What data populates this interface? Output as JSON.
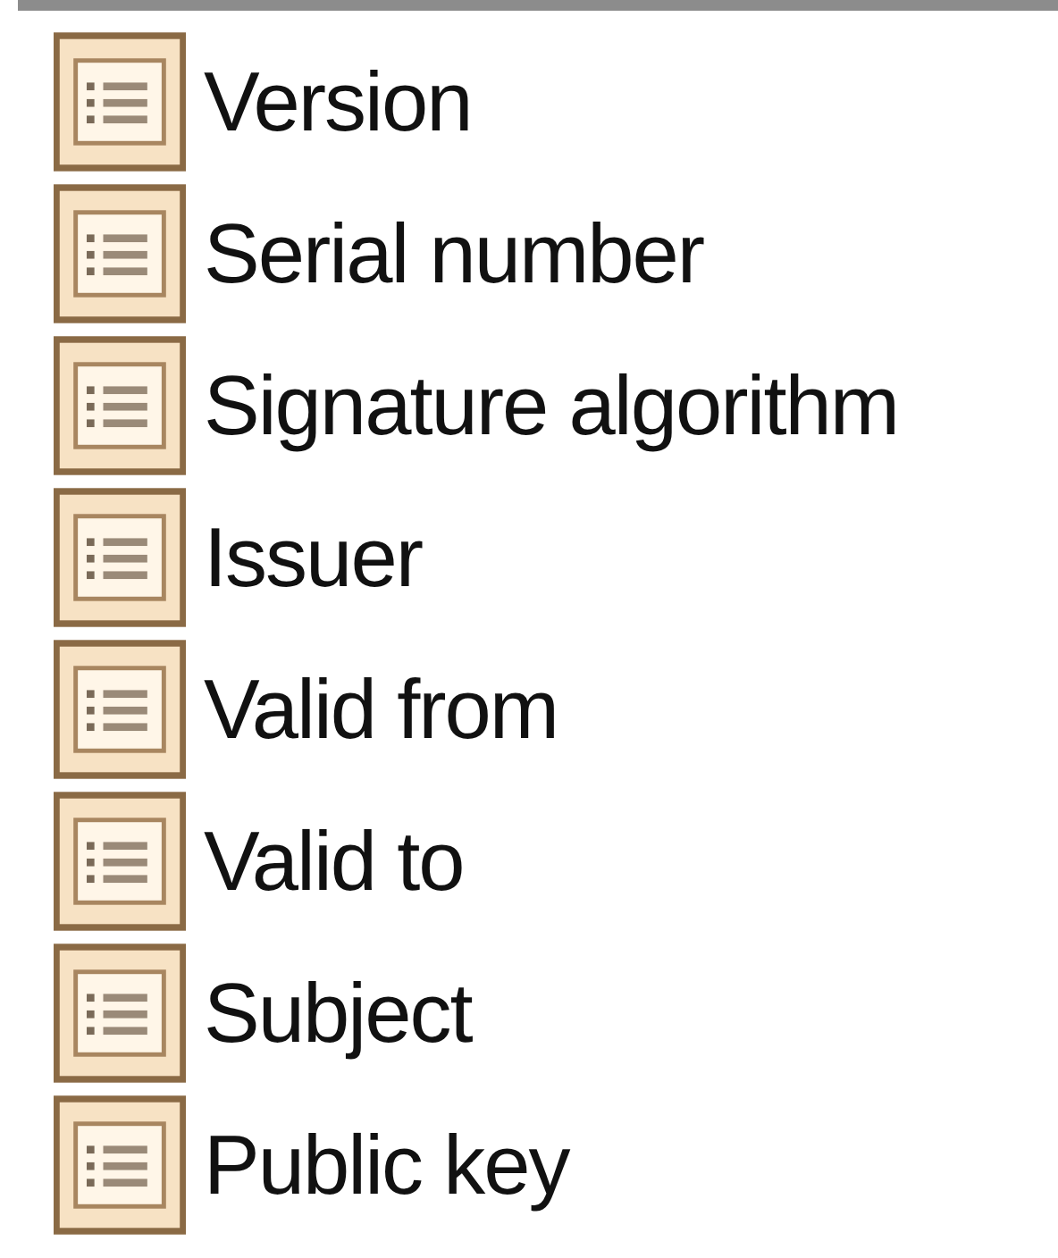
{
  "fields": [
    {
      "label": "Version"
    },
    {
      "label": "Serial number"
    },
    {
      "label": "Signature algorithm"
    },
    {
      "label": "Issuer"
    },
    {
      "label": "Valid from"
    },
    {
      "label": "Valid to"
    },
    {
      "label": "Subject"
    },
    {
      "label": "Public key"
    }
  ]
}
